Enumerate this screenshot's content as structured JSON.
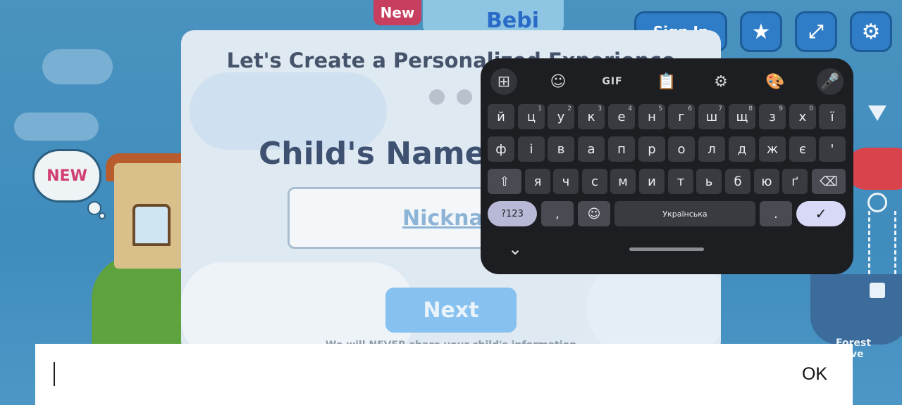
{
  "background": {
    "new_bubble": "NEW",
    "top_badge": "New",
    "top_banner": "Bebi",
    "boat_sign": "Forest Adve"
  },
  "header": {
    "signin_label": "Sign In",
    "star_icon": "★",
    "share_icon": "⤢",
    "gear_icon": "⚙"
  },
  "dialog": {
    "title": "Let's Create a Personalized Experience",
    "prompt": "Child's Name or",
    "nickname_placeholder": "Nickname",
    "next_label": "Next",
    "footer": "We will NEVER share your child's information"
  },
  "keyboard": {
    "toolbar": {
      "apps": "⊞",
      "sticker": "☺",
      "gif": "GIF",
      "clipboard": "📋",
      "settings": "⚙",
      "theme": "🎨",
      "mic": "🎤"
    },
    "row1": [
      {
        "k": "й",
        "h": ""
      },
      {
        "k": "ц",
        "h": "1"
      },
      {
        "k": "у",
        "h": "2"
      },
      {
        "k": "к",
        "h": "3"
      },
      {
        "k": "е",
        "h": "4"
      },
      {
        "k": "н",
        "h": "5"
      },
      {
        "k": "г",
        "h": "6"
      },
      {
        "k": "ш",
        "h": "7"
      },
      {
        "k": "щ",
        "h": "8"
      },
      {
        "k": "з",
        "h": "9"
      },
      {
        "k": "х",
        "h": "0"
      },
      {
        "k": "ї",
        "h": ""
      }
    ],
    "row2": [
      "ф",
      "і",
      "в",
      "а",
      "п",
      "р",
      "о",
      "л",
      "д",
      "ж",
      "є",
      "'"
    ],
    "row3": [
      "я",
      "ч",
      "с",
      "м",
      "и",
      "т",
      "ь",
      "б",
      "ю",
      "ґ"
    ],
    "shift": "⇧",
    "backspace": "⌫",
    "mode": "?123",
    "comma": ",",
    "emoji": "☺",
    "space": "Українська",
    "period": ".",
    "enter": "✓",
    "collapse": "⌄"
  },
  "navigation": {
    "back": "▼",
    "home": "○",
    "recents": "□"
  },
  "editbar": {
    "text": "",
    "ok_label": "OK"
  }
}
